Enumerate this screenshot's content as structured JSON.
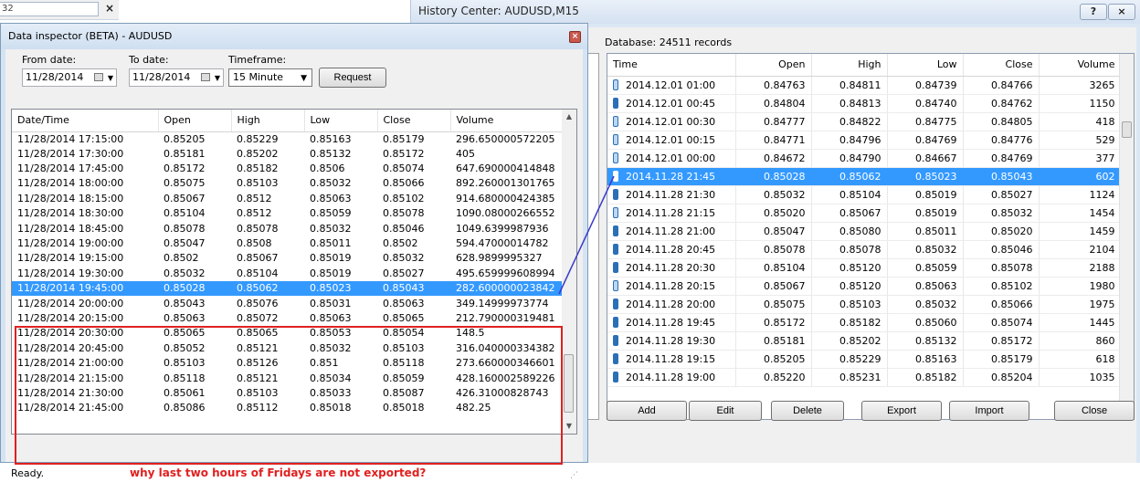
{
  "background_window": {
    "fragment_text": "32",
    "close_glyph": "×"
  },
  "history_center": {
    "title": "History Center: AUDUSD,M15",
    "help_glyph": "?",
    "close_glyph": "×",
    "database_info": "Database: 24511 records",
    "columns": [
      "Time",
      "Open",
      "High",
      "Low",
      "Close",
      "Volume"
    ],
    "rows": [
      {
        "time": "2014.12.01 01:00",
        "open": "0.84763",
        "high": "0.84811",
        "low": "0.84739",
        "close": "0.84766",
        "volume": "3265",
        "icon": "light"
      },
      {
        "time": "2014.12.01 00:45",
        "open": "0.84804",
        "high": "0.84813",
        "low": "0.84740",
        "close": "0.84762",
        "volume": "1150",
        "icon": "dark"
      },
      {
        "time": "2014.12.01 00:30",
        "open": "0.84777",
        "high": "0.84822",
        "low": "0.84775",
        "close": "0.84805",
        "volume": "418",
        "icon": "light"
      },
      {
        "time": "2014.12.01 00:15",
        "open": "0.84771",
        "high": "0.84796",
        "low": "0.84769",
        "close": "0.84776",
        "volume": "529",
        "icon": "light"
      },
      {
        "time": "2014.12.01 00:00",
        "open": "0.84672",
        "high": "0.84790",
        "low": "0.84667",
        "close": "0.84769",
        "volume": "377",
        "icon": "light"
      },
      {
        "time": "2014.11.28 21:45",
        "open": "0.85028",
        "high": "0.85062",
        "low": "0.85023",
        "close": "0.85043",
        "volume": "602",
        "icon": "light",
        "selected": true
      },
      {
        "time": "2014.11.28 21:30",
        "open": "0.85032",
        "high": "0.85104",
        "low": "0.85019",
        "close": "0.85027",
        "volume": "1124",
        "icon": "dark"
      },
      {
        "time": "2014.11.28 21:15",
        "open": "0.85020",
        "high": "0.85067",
        "low": "0.85019",
        "close": "0.85032",
        "volume": "1454",
        "icon": "light"
      },
      {
        "time": "2014.11.28 21:00",
        "open": "0.85047",
        "high": "0.85080",
        "low": "0.85011",
        "close": "0.85020",
        "volume": "1459",
        "icon": "dark"
      },
      {
        "time": "2014.11.28 20:45",
        "open": "0.85078",
        "high": "0.85078",
        "low": "0.85032",
        "close": "0.85046",
        "volume": "2104",
        "icon": "dark"
      },
      {
        "time": "2014.11.28 20:30",
        "open": "0.85104",
        "high": "0.85120",
        "low": "0.85059",
        "close": "0.85078",
        "volume": "2188",
        "icon": "dark"
      },
      {
        "time": "2014.11.28 20:15",
        "open": "0.85067",
        "high": "0.85120",
        "low": "0.85063",
        "close": "0.85102",
        "volume": "1980",
        "icon": "light"
      },
      {
        "time": "2014.11.28 20:00",
        "open": "0.85075",
        "high": "0.85103",
        "low": "0.85032",
        "close": "0.85066",
        "volume": "1975",
        "icon": "dark"
      },
      {
        "time": "2014.11.28 19:45",
        "open": "0.85172",
        "high": "0.85182",
        "low": "0.85060",
        "close": "0.85074",
        "volume": "1445",
        "icon": "dark"
      },
      {
        "time": "2014.11.28 19:30",
        "open": "0.85181",
        "high": "0.85202",
        "low": "0.85132",
        "close": "0.85172",
        "volume": "860",
        "icon": "dark"
      },
      {
        "time": "2014.11.28 19:15",
        "open": "0.85205",
        "high": "0.85229",
        "low": "0.85163",
        "close": "0.85179",
        "volume": "618",
        "icon": "dark"
      },
      {
        "time": "2014.11.28 19:00",
        "open": "0.85220",
        "high": "0.85231",
        "low": "0.85182",
        "close": "0.85204",
        "volume": "1035",
        "icon": "dark"
      }
    ],
    "buttons": {
      "add": "Add",
      "edit": "Edit",
      "delete": "Delete",
      "export": "Export",
      "import": "Import",
      "close": "Close"
    }
  },
  "data_inspector": {
    "title": "Data inspector (BETA) -  AUDUSD",
    "close_glyph": "×",
    "from_label": "From date:",
    "from_value": "11/28/2014",
    "to_label": "To date:",
    "to_value": "11/28/2014",
    "timeframe_label": "Timeframe:",
    "timeframe_value": "15 Minute",
    "request_label": "Request",
    "columns": [
      "Date/Time",
      "Open",
      "High",
      "Low",
      "Close",
      "Volume"
    ],
    "rows": [
      [
        "11/28/2014 17:15:00",
        "0.85205",
        "0.85229",
        "0.85163",
        "0.85179",
        "296.650000572205"
      ],
      [
        "11/28/2014 17:30:00",
        "0.85181",
        "0.85202",
        "0.85132",
        "0.85172",
        "405"
      ],
      [
        "11/28/2014 17:45:00",
        "0.85172",
        "0.85182",
        "0.8506",
        "0.85074",
        "647.690000414848"
      ],
      [
        "11/28/2014 18:00:00",
        "0.85075",
        "0.85103",
        "0.85032",
        "0.85066",
        "892.260001301765"
      ],
      [
        "11/28/2014 18:15:00",
        "0.85067",
        "0.8512",
        "0.85063",
        "0.85102",
        "914.680000424385"
      ],
      [
        "11/28/2014 18:30:00",
        "0.85104",
        "0.8512",
        "0.85059",
        "0.85078",
        "1090.08000266552"
      ],
      [
        "11/28/2014 18:45:00",
        "0.85078",
        "0.85078",
        "0.85032",
        "0.85046",
        "1049.6399987936"
      ],
      [
        "11/28/2014 19:00:00",
        "0.85047",
        "0.8508",
        "0.85011",
        "0.8502",
        "594.47000014782"
      ],
      [
        "11/28/2014 19:15:00",
        "0.8502",
        "0.85067",
        "0.85019",
        "0.85032",
        "628.9899995327"
      ],
      [
        "11/28/2014 19:30:00",
        "0.85032",
        "0.85104",
        "0.85019",
        "0.85027",
        "495.659999608994"
      ],
      [
        "11/28/2014 19:45:00",
        "0.85028",
        "0.85062",
        "0.85023",
        "0.85043",
        "282.600000023842"
      ],
      [
        "11/28/2014 20:00:00",
        "0.85043",
        "0.85076",
        "0.85031",
        "0.85063",
        "349.14999973774"
      ],
      [
        "11/28/2014 20:15:00",
        "0.85063",
        "0.85072",
        "0.85063",
        "0.85065",
        "212.790000319481"
      ],
      [
        "11/28/2014 20:30:00",
        "0.85065",
        "0.85065",
        "0.85053",
        "0.85054",
        "148.5"
      ],
      [
        "11/28/2014 20:45:00",
        "0.85052",
        "0.85121",
        "0.85032",
        "0.85103",
        "316.040000334382"
      ],
      [
        "11/28/2014 21:00:00",
        "0.85103",
        "0.85126",
        "0.851",
        "0.85118",
        "273.660000346601"
      ],
      [
        "11/28/2014 21:15:00",
        "0.85118",
        "0.85121",
        "0.85034",
        "0.85059",
        "428.160002589226"
      ],
      [
        "11/28/2014 21:30:00",
        "0.85061",
        "0.85103",
        "0.85033",
        "0.85087",
        "426.31000828743"
      ],
      [
        "11/28/2014 21:45:00",
        "0.85086",
        "0.85112",
        "0.85018",
        "0.85018",
        "482.25"
      ]
    ],
    "selected_row": 10,
    "status": "Ready.",
    "annotation": "why last two hours of Fridays are not exported?"
  },
  "colors": {
    "selection": "#3399ff",
    "annotation_red": "#e02020",
    "connector": "#3a3acc"
  }
}
